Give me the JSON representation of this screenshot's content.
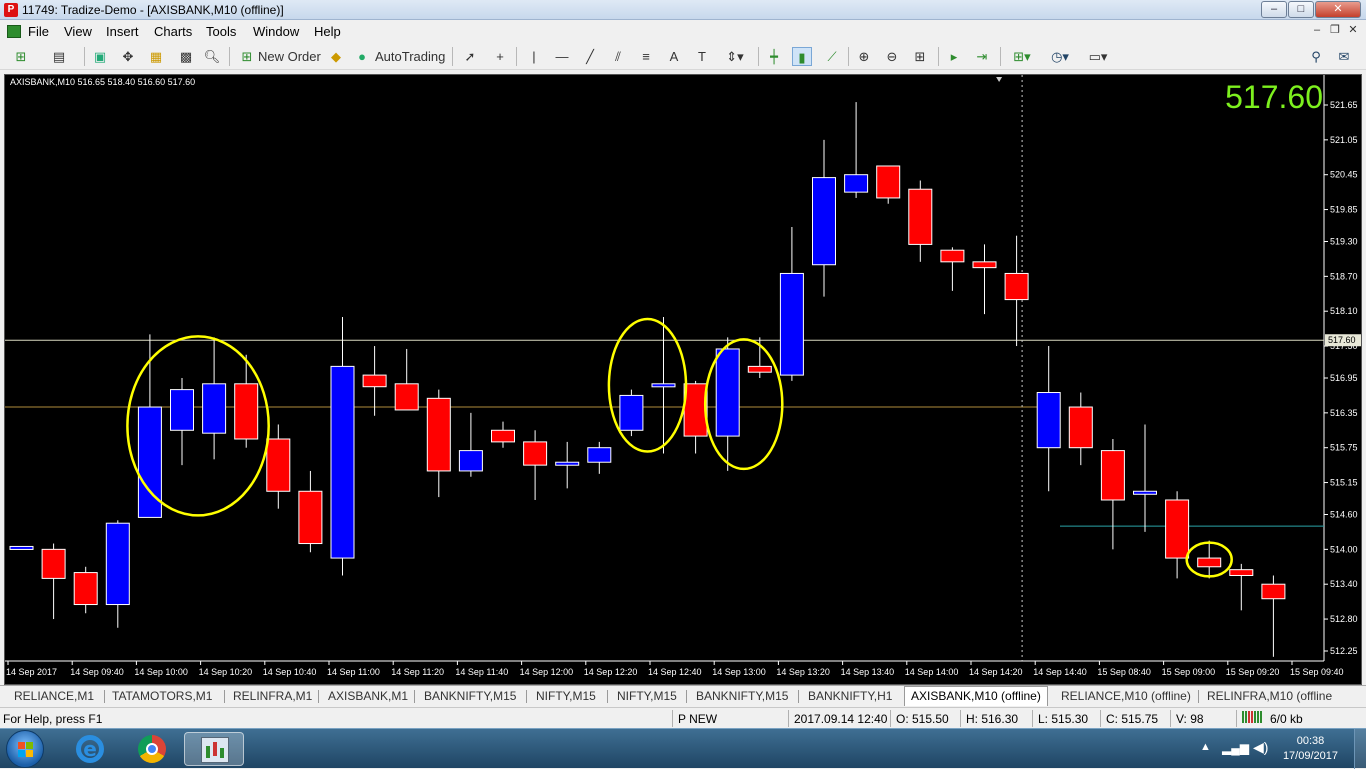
{
  "window": {
    "title": "11749: Tradize-Demo - [AXISBANK,M10 (offline)]",
    "app_icon_letter": "P",
    "controls": [
      "–",
      "□",
      "✕"
    ]
  },
  "menu": {
    "items": [
      "File",
      "View",
      "Insert",
      "Charts",
      "Tools",
      "Window",
      "Help"
    ]
  },
  "toolbar": {
    "new_order": "New Order",
    "autotrading": "AutoTrading",
    "text_tool": "A"
  },
  "chart": {
    "header": "AXISBANK,M10  516.65 518.40 516.60 517.60",
    "big_price": "517.60",
    "price_label_current": "517.60",
    "colors": {
      "bull": "#0000ff",
      "bear": "#ff0000",
      "background": "#000000",
      "text": "#ffffff",
      "highlight_circle": "#ffff00",
      "level_line": "#b08d3c",
      "support_line": "#2aa4a8",
      "big_price": "#7df01e"
    }
  },
  "chart_data": {
    "type": "candlestick",
    "symbol": "AXISBANK",
    "timeframe": "M10",
    "ylim": [
      512.25,
      521.65
    ],
    "y_ticks": [
      "521.65",
      "521.05",
      "520.45",
      "519.85",
      "519.30",
      "518.70",
      "518.10",
      "517.50",
      "516.95",
      "516.35",
      "515.75",
      "515.15",
      "514.60",
      "514.00",
      "513.40",
      "512.80",
      "512.25"
    ],
    "x_ticks": [
      "14 Sep 2017",
      "14 Sep 09:40",
      "14 Sep 10:00",
      "14 Sep 10:20",
      "14 Sep 10:40",
      "14 Sep 11:00",
      "14 Sep 11:20",
      "14 Sep 11:40",
      "14 Sep 12:00",
      "14 Sep 12:20",
      "14 Sep 12:40",
      "14 Sep 13:00",
      "14 Sep 13:20",
      "14 Sep 13:40",
      "14 Sep 14:00",
      "14 Sep 14:20",
      "14 Sep 14:40",
      "15 Sep 08:40",
      "15 Sep 09:00",
      "15 Sep 09:20",
      "15 Sep 09:40"
    ],
    "candles": [
      {
        "o": 514.0,
        "h": 514.0,
        "l": 514.0,
        "c": 514.05
      },
      {
        "o": 514.0,
        "h": 514.1,
        "l": 512.8,
        "c": 513.5
      },
      {
        "o": 513.6,
        "h": 513.7,
        "l": 512.9,
        "c": 513.05
      },
      {
        "o": 513.05,
        "h": 514.5,
        "l": 512.65,
        "c": 514.45
      },
      {
        "o": 514.55,
        "h": 517.7,
        "l": 514.55,
        "c": 516.45
      },
      {
        "o": 516.05,
        "h": 516.95,
        "l": 515.45,
        "c": 516.75
      },
      {
        "o": 516.0,
        "h": 517.65,
        "l": 515.55,
        "c": 516.85
      },
      {
        "o": 516.85,
        "h": 517.35,
        "l": 515.75,
        "c": 515.9
      },
      {
        "o": 515.9,
        "h": 516.15,
        "l": 514.7,
        "c": 515.0
      },
      {
        "o": 515.0,
        "h": 515.35,
        "l": 513.95,
        "c": 514.1
      },
      {
        "o": 513.85,
        "h": 518.0,
        "l": 513.55,
        "c": 517.15
      },
      {
        "o": 517.0,
        "h": 517.5,
        "l": 516.3,
        "c": 516.8
      },
      {
        "o": 516.85,
        "h": 517.45,
        "l": 516.55,
        "c": 516.4
      },
      {
        "o": 516.6,
        "h": 516.75,
        "l": 514.9,
        "c": 515.35
      },
      {
        "o": 515.35,
        "h": 516.35,
        "l": 515.25,
        "c": 515.7
      },
      {
        "o": 516.05,
        "h": 516.2,
        "l": 515.75,
        "c": 515.85
      },
      {
        "o": 515.85,
        "h": 516.05,
        "l": 514.85,
        "c": 515.45
      },
      {
        "o": 515.45,
        "h": 515.85,
        "l": 515.05,
        "c": 515.5
      },
      {
        "o": 515.5,
        "h": 515.85,
        "l": 515.3,
        "c": 515.75
      },
      {
        "o": 516.05,
        "h": 516.75,
        "l": 515.95,
        "c": 516.65
      },
      {
        "o": 516.8,
        "h": 518.0,
        "l": 515.65,
        "c": 516.85
      },
      {
        "o": 516.85,
        "h": 516.9,
        "l": 515.65,
        "c": 515.95
      },
      {
        "o": 515.95,
        "h": 517.65,
        "l": 515.35,
        "c": 517.45
      },
      {
        "o": 517.15,
        "h": 517.65,
        "l": 516.95,
        "c": 517.05
      },
      {
        "o": 517.0,
        "h": 519.55,
        "l": 516.9,
        "c": 518.75
      },
      {
        "o": 518.9,
        "h": 521.05,
        "l": 518.35,
        "c": 520.4
      },
      {
        "o": 520.15,
        "h": 521.7,
        "l": 520.05,
        "c": 520.45
      },
      {
        "o": 520.6,
        "h": 520.6,
        "l": 519.95,
        "c": 520.05
      },
      {
        "o": 520.2,
        "h": 520.35,
        "l": 518.95,
        "c": 519.25
      },
      {
        "o": 519.15,
        "h": 519.2,
        "l": 518.45,
        "c": 518.95
      },
      {
        "o": 518.95,
        "h": 519.25,
        "l": 518.05,
        "c": 518.85
      },
      {
        "o": 518.75,
        "h": 519.4,
        "l": 517.5,
        "c": 518.3
      },
      {
        "o": 515.75,
        "h": 517.5,
        "l": 515.0,
        "c": 516.7
      },
      {
        "o": 516.45,
        "h": 516.7,
        "l": 515.45,
        "c": 515.75
      },
      {
        "o": 515.7,
        "h": 515.9,
        "l": 514.0,
        "c": 514.85
      },
      {
        "o": 514.95,
        "h": 516.15,
        "l": 514.3,
        "c": 515.0
      },
      {
        "o": 514.85,
        "h": 515.0,
        "l": 513.5,
        "c": 513.85
      },
      {
        "o": 513.85,
        "h": 514.15,
        "l": 513.5,
        "c": 513.7
      },
      {
        "o": 513.65,
        "h": 513.75,
        "l": 512.95,
        "c": 513.55
      },
      {
        "o": 513.4,
        "h": 513.55,
        "l": 512.15,
        "c": 513.15
      }
    ],
    "horizontal_lines": [
      {
        "price": 517.6,
        "color": "#d9d9c0"
      },
      {
        "price": 516.45,
        "color": "#b08d3c"
      },
      {
        "price": 514.4,
        "color": "#2aa4a8"
      }
    ],
    "vertical_lines": [
      {
        "label": "15 Sep 08:40",
        "style": "dotted"
      }
    ],
    "highlight_circles": [
      {
        "from_candle": 4,
        "to_candle": 7
      },
      {
        "from_candle": 19,
        "to_candle": 20
      },
      {
        "from_candle": 22,
        "to_candle": 23
      },
      {
        "from_candle": 37,
        "to_candle": 37
      }
    ]
  },
  "tabs": {
    "items": [
      "RELIANCE,M1",
      "TATAMOTORS,M1",
      "RELINFRA,M1",
      "AXISBANK,M1",
      "BANKNIFTY,M15",
      "NIFTY,M15",
      "NIFTY,M15",
      "BANKNIFTY,M15",
      "BANKNIFTY,H1",
      "AXISBANK,M10 (offline)",
      "RELIANCE,M10 (offline)",
      "RELINFRA,M10 (offline"
    ],
    "active_index": 9
  },
  "status": {
    "help": "For Help, press F1",
    "profile": "P NEW",
    "datetime": "2017.09.14 12:40",
    "open": "O: 515.50",
    "high": "H: 516.30",
    "low": "L: 515.30",
    "close": "C: 515.75",
    "volume": "V: 98",
    "traffic": "6/0 kb"
  },
  "taskbar": {
    "time": "00:38",
    "date": "17/09/2017"
  }
}
